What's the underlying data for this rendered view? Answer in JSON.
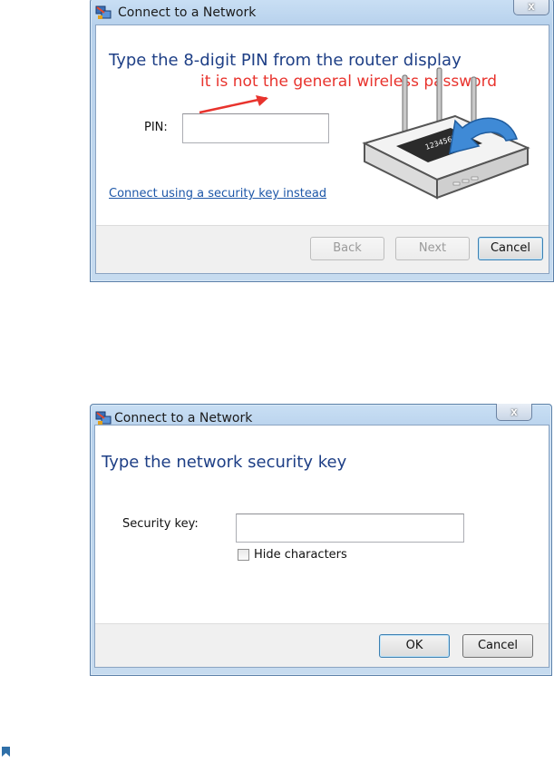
{
  "dialog1": {
    "title": "Connect to a Network",
    "close_label": "x",
    "heading": "Type the 8-digit PIN from the router display",
    "annotation": "it is not the general wireless password",
    "pin_label": "PIN:",
    "pin_value": "",
    "alt_link": "Connect using a security key instead",
    "router_display_text": "12345678",
    "buttons": {
      "back": "Back",
      "next": "Next",
      "cancel": "Cancel"
    }
  },
  "dialog2": {
    "title": "Connect to a Network",
    "close_label": "x",
    "heading": "Type the network security key",
    "key_label": "Security key:",
    "key_value": "",
    "hide_characters_label": "Hide characters",
    "hide_characters_checked": false,
    "buttons": {
      "ok": "OK",
      "cancel": "Cancel"
    }
  },
  "colors": {
    "heading": "#1e3f86",
    "link": "#1d57a8",
    "annotation": "#e8332d",
    "footer": "#f0f0f0"
  },
  "icons": [
    "network-icon",
    "close-icon",
    "router-icon",
    "arrow-icon",
    "bookmark-icon",
    "checkbox-icon"
  ]
}
